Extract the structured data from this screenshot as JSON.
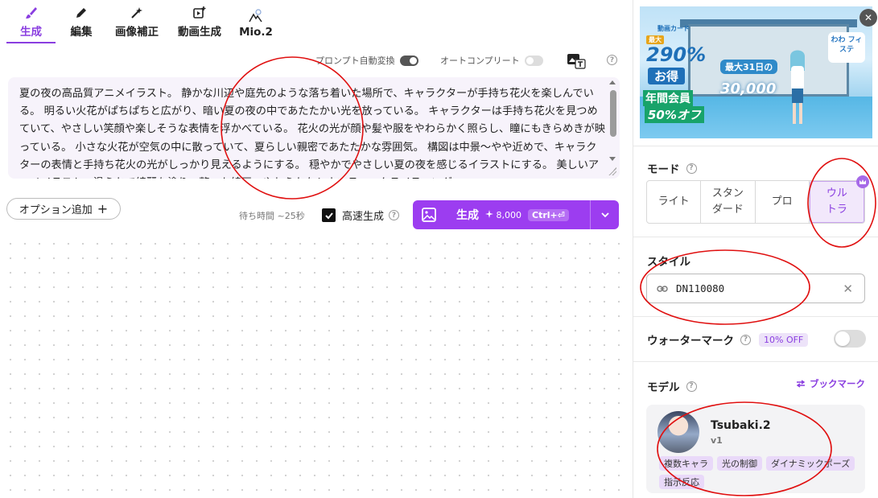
{
  "tabs": [
    {
      "label": "生成",
      "icon": "brush-icon",
      "active": true
    },
    {
      "label": "編集",
      "icon": "pencil-icon",
      "active": false
    },
    {
      "label": "画像補正",
      "icon": "magic-wand-icon",
      "active": false
    },
    {
      "label": "動画生成",
      "icon": "video-plus-icon",
      "active": false
    },
    {
      "label": "Mio.2",
      "icon": "mountain-icon",
      "active": false
    }
  ],
  "toggles": {
    "prompt_convert": {
      "label": "プロンプト自動変換",
      "on": true
    },
    "autocomplete": {
      "label": "オートコンプリート",
      "on": false
    }
  },
  "prompt": {
    "text": "夏の夜の高品質アニメイラスト。 静かな川辺や庭先のような落ち着いた場所で、キャラクターが手持ち花火を楽しんでいる。 明るい火花がぱちぱちと広がり、暗い夏の夜の中であたたかい光を放っている。 キャラクターは手持ち花火を見つめていて、やさしい笑顔や楽しそうな表情を浮かべている。 花火の光が顔や髪や服をやわらかく照らし、瞳にもきらめきが映っている。 小さな火花が空気の中に散っていて、夏らしい親密であたたかな雰囲気。 構図は中景〜やや近めで、キャラクターの表情と手持ち花火の光がしっかり見えるようにする。 穏やかでやさしい夏の夜を感じるイラストにする。 美しいアニメイラスト、滑らかで綺麗な塗り、整った線画、やわらかなシネマティックライティング。"
  },
  "actions": {
    "add_option": "オプション追加",
    "add_option_icon": "+",
    "wait_time": "待ち時間 ~25秒",
    "fast_gen": "高速生成",
    "fast_gen_checked": true,
    "generate_label": "生成",
    "generate_cost": "8,000",
    "generate_shortcut": "Ctrl+⏎"
  },
  "banner": {
    "tag": "動画カード",
    "max": "最大",
    "percent": "290%",
    "deal": "お得",
    "mid_text": "最大31日の",
    "mid_amount": "30,000",
    "annual": "年間会員",
    "off": "50%オフ",
    "sign": "わわ フィステ"
  },
  "mode": {
    "title": "モード",
    "options": [
      "ライト",
      "スタン\nダード",
      "プロ",
      "ウル\nトラ"
    ],
    "selected_index": 3
  },
  "style": {
    "title": "スタイル",
    "value": "DN110080"
  },
  "watermark": {
    "label": "ウォーターマーク",
    "badge": "10% OFF",
    "on": false
  },
  "model": {
    "title": "モデル",
    "bookmark": "ブックマーク",
    "name": "Tsubaki.2",
    "version": "v1",
    "tags": [
      "複数キャラ",
      "光の制御",
      "ダイナミックポーズ",
      "指示反応"
    ]
  },
  "colors": {
    "accent": "#9c3df0",
    "annotation": "#e01010"
  }
}
